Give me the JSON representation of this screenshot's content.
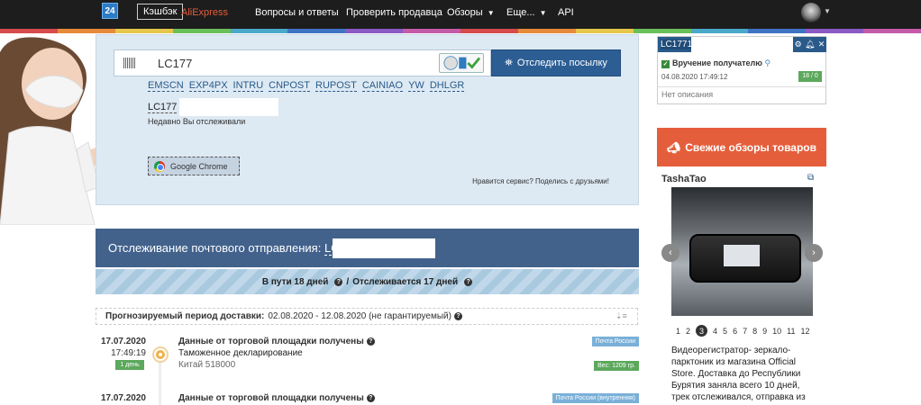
{
  "topbar": {
    "logo": "24",
    "cashback": "Кэшбэк",
    "aliexpress": "AliExpress",
    "nav": [
      "Вопросы и ответы",
      "Проверить продавца",
      "Обзоры",
      "Еще...",
      "API"
    ],
    "colors": {
      "bg": "#1d1d1d",
      "ali": "#e55e3b"
    }
  },
  "track": {
    "input_value": "LC177",
    "button": "Отследить посылку",
    "carriers": [
      "EMSCN",
      "EXP4PX",
      "INTRU",
      "CNPOST",
      "RUPOST",
      "CAINIAO",
      "YW",
      "DHLGR"
    ],
    "recent_number": "LC177",
    "recent_label": "Недавно Вы отслеживали",
    "chrome_button": "Google Chrome",
    "share": "Нравится сервис? Поделись с друзьями!"
  },
  "tracking_header": {
    "label": "Отслеживание почтового отправления:",
    "number": "LC177"
  },
  "transit": {
    "in_transit": "В пути 18 дней",
    "separator": "/",
    "tracked": "Отслеживается 17 дней"
  },
  "forecast": {
    "label": "Прогнозируемый период доставки:",
    "value": "02.08.2020 - 12.08.2020 (не гарантируемый)"
  },
  "events": [
    {
      "date": "17.07.2020",
      "time": "17:49:19",
      "days": "1 день",
      "title": "Данные от торговой площадки получены",
      "subtitle": "Таможенное декларирование",
      "location": "Китай 518000",
      "tag": "Почта России",
      "weight": "Вес: 1209 гр."
    },
    {
      "date": "17.07.2020",
      "title": "Данные от торговой площадки получены",
      "tag": "Почта России (внутренняя)"
    }
  ],
  "widget": {
    "number": "LC1771",
    "status": "Вручение получателю",
    "date": "04.08.2020 17:49:12",
    "count": "18 / 0",
    "description": "Нет описания"
  },
  "reviews": {
    "button": "Свежие обзоры товаров",
    "author": "TashaTao",
    "pages": [
      "1",
      "2",
      "3",
      "4",
      "5",
      "6",
      "7",
      "8",
      "9",
      "10",
      "11",
      "12"
    ],
    "active_page": "3",
    "text": "Видеорегистратор- зеркало-парктоник из магазина Official Store. Доставка до Республики Бурятия заняла всего 10 дней, трек отслеживался, отправка из"
  }
}
